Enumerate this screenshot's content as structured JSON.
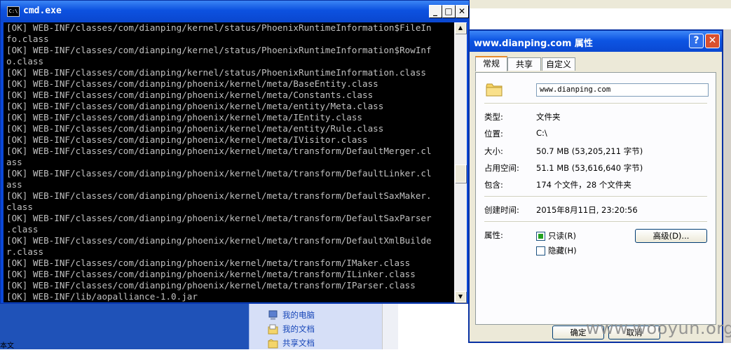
{
  "background": {
    "top_strip_text": "",
    "left_text": "本文",
    "explorer_items": [
      {
        "label": "我的电脑",
        "icon": "computer-icon"
      },
      {
        "label": "我的文档",
        "icon": "documents-icon"
      },
      {
        "label": "共享文档",
        "icon": "shared-folder-icon"
      }
    ]
  },
  "cmd": {
    "title": "cmd.exe",
    "icon_text": "C:\\",
    "controls": {
      "minimize": "_",
      "maximize": "□",
      "close": "✕"
    },
    "lines": [
      "[OK] WEB-INF/classes/com/dianping/kernel/status/PhoenixRuntimeInformation$FileIn",
      "fo.class",
      "[OK] WEB-INF/classes/com/dianping/kernel/status/PhoenixRuntimeInformation$RowInf",
      "o.class",
      "[OK] WEB-INF/classes/com/dianping/kernel/status/PhoenixRuntimeInformation.class",
      "[OK] WEB-INF/classes/com/dianping/phoenix/kernel/meta/BaseEntity.class",
      "[OK] WEB-INF/classes/com/dianping/phoenix/kernel/meta/Constants.class",
      "[OK] WEB-INF/classes/com/dianping/phoenix/kernel/meta/entity/Meta.class",
      "[OK] WEB-INF/classes/com/dianping/phoenix/kernel/meta/IEntity.class",
      "[OK] WEB-INF/classes/com/dianping/phoenix/kernel/meta/entity/Rule.class",
      "[OK] WEB-INF/classes/com/dianping/phoenix/kernel/meta/IVisitor.class",
      "[OK] WEB-INF/classes/com/dianping/phoenix/kernel/meta/transform/DefaultMerger.cl",
      "ass",
      "[OK] WEB-INF/classes/com/dianping/phoenix/kernel/meta/transform/DefaultLinker.cl",
      "ass",
      "[OK] WEB-INF/classes/com/dianping/phoenix/kernel/meta/transform/DefaultSaxMaker.",
      "class",
      "[OK] WEB-INF/classes/com/dianping/phoenix/kernel/meta/transform/DefaultSaxParser",
      ".class",
      "[OK] WEB-INF/classes/com/dianping/phoenix/kernel/meta/transform/DefaultXmlBuilde",
      "r.class",
      "[OK] WEB-INF/classes/com/dianping/phoenix/kernel/meta/transform/IMaker.class",
      "[OK] WEB-INF/classes/com/dianping/phoenix/kernel/meta/transform/ILinker.class",
      "[OK] WEB-INF/classes/com/dianping/phoenix/kernel/meta/transform/IParser.class",
      "[OK] WEB-INF/lib/aopalliance-1.0.jar"
    ],
    "scroll_up": "▲",
    "scroll_down": "▼"
  },
  "props": {
    "title": "www.dianping.com 属性",
    "help": "?",
    "close": "✕",
    "tabs": [
      "常规",
      "共享",
      "自定义"
    ],
    "name": "www.dianping.com",
    "rows": [
      {
        "label": "类型:",
        "value": "文件夹"
      },
      {
        "label": "位置:",
        "value": "C:\\"
      },
      {
        "label": "大小:",
        "value": "50.7 MB (53,205,211 字节)"
      },
      {
        "label": "占用空间:",
        "value": "51.1 MB (53,616,640 字节)"
      },
      {
        "label": "包含:",
        "value": "174 个文件，28 个文件夹"
      },
      {
        "label": "创建时间:",
        "value": "2015年8月11日, 23:20:56"
      }
    ],
    "attributes_label": "属性:",
    "readonly_label": "只读(R)",
    "readonly_checked": true,
    "hidden_label": "隐藏(H)",
    "hidden_checked": false,
    "advanced_label": "高级(D)...",
    "ok_label": "确定",
    "cancel_label": "取消"
  },
  "watermark": "www.wooyun.org"
}
